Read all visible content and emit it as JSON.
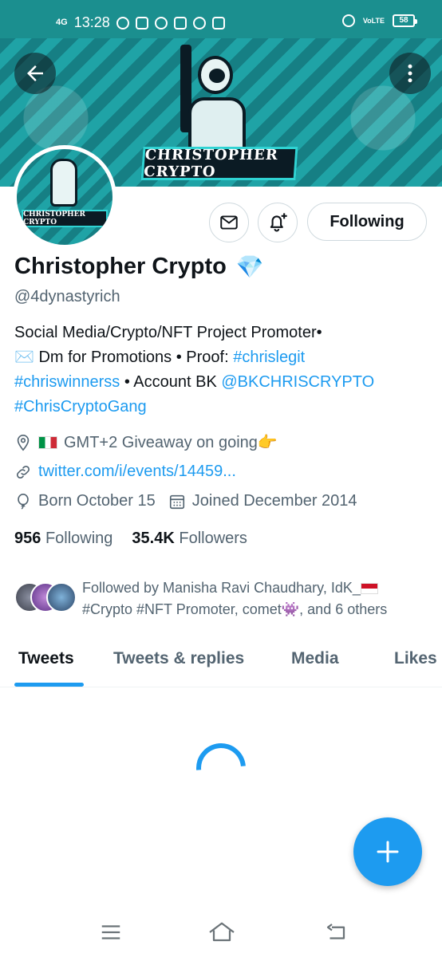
{
  "status_bar": {
    "network": "4G",
    "time": "13:28",
    "volte": "VoLTE",
    "battery": "58"
  },
  "banner": {
    "logo_text": "CHRISTOPHER CRYPTO"
  },
  "avatar": {
    "logo_text": "CHRISTOPHER CRYPTO"
  },
  "actions": {
    "following_label": "Following"
  },
  "profile": {
    "name": "Christopher Crypto",
    "verified_emoji": "💎",
    "handle": "@4dynastyrich",
    "bio": {
      "line1": "Social Media/Crypto/NFT Project Promoter•",
      "line2_emoji": "✉️",
      "line2_text": " Dm for Promotions • Proof: ",
      "line2_tag": "#chrislegit",
      "line3_tag": "#chriswinnerss",
      "line3_text": " • Account BK ",
      "line3_mention": "@BKCHRISCRYPTO",
      "line4_tag": "#ChrisCryptoGang"
    },
    "location": "GMT+2 Giveaway on going👉",
    "website": "twitter.com/i/events/14459...",
    "birthday": "Born October 15",
    "joined": "Joined December 2014",
    "following_count": "956",
    "following_label": "Following",
    "followers_count": "35.4K",
    "followers_label": "Followers"
  },
  "followed_by": {
    "line1": "Followed by Manisha Ravi Chaudhary, IdK_",
    "line2a": "#Crypto #NFT Promoter, comet",
    "invader": "👾",
    "line2b": ", and 6 others"
  },
  "tabs": [
    "Tweets",
    "Tweets & replies",
    "Media",
    "Likes"
  ],
  "colors": {
    "accent": "#1d9bf0",
    "status_bar": "#1b8f8f",
    "text_primary": "#0f1419",
    "text_secondary": "#536471"
  },
  "icons": {
    "back": "arrow-left-icon",
    "more": "more-vertical-icon",
    "mail": "mail-icon",
    "bell": "bell-plus-icon",
    "location": "location-icon",
    "link": "link-icon",
    "birthday": "balloon-icon",
    "calendar": "calendar-icon",
    "compose": "plus-icon"
  }
}
